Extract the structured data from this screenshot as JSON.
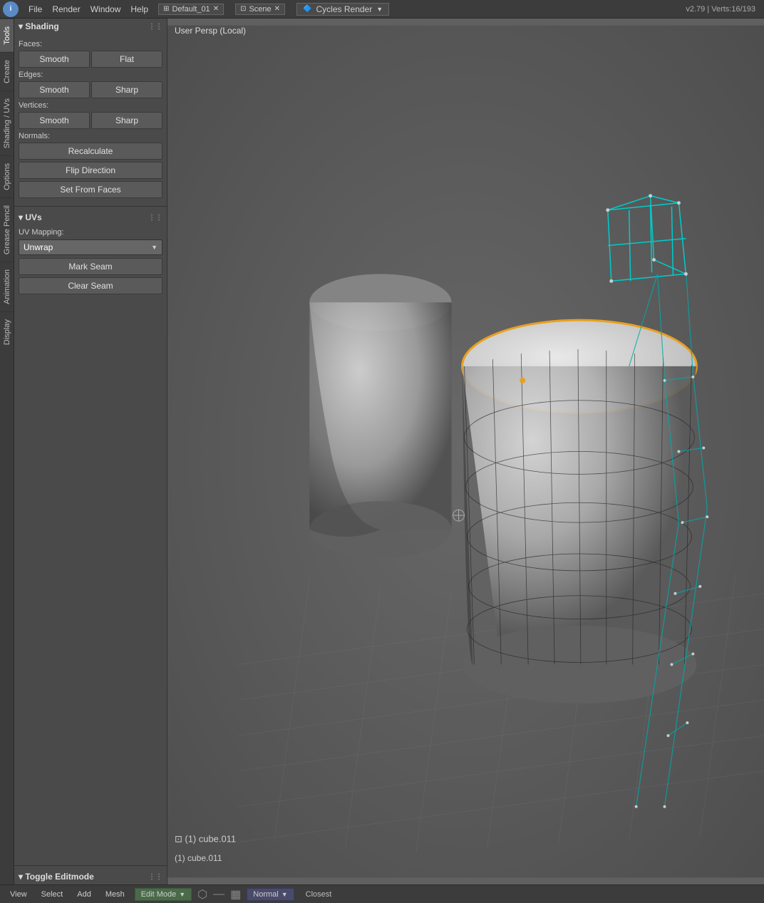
{
  "topbar": {
    "icon": "i",
    "menus": [
      "File",
      "Render",
      "Window",
      "Help"
    ],
    "screen_name": "Default_01",
    "scene_name": "Scene",
    "render_engine": "Cycles Render",
    "version": "v2.79 | Verts:16/193"
  },
  "sidebar": {
    "tabs": [
      "Tools",
      "Create",
      "Shading / UVs",
      "Options",
      "Grease Pencil",
      "Animation",
      "Display"
    ]
  },
  "shading": {
    "section_label": "Shading",
    "faces_label": "Faces:",
    "smooth_face_label": "Smooth",
    "flat_face_label": "Flat",
    "edges_label": "Edges:",
    "smooth_edge_label": "Smooth",
    "sharp_edge_label": "Sharp",
    "vertices_label": "Vertices:",
    "smooth_vert_label": "Smooth",
    "sharp_vert_label": "Sharp",
    "normals_label": "Normals:",
    "recalculate_label": "Recalculate",
    "flip_direction_label": "Flip Direction",
    "set_from_faces_label": "Set From Faces"
  },
  "uvs": {
    "section_label": "UVs",
    "uv_mapping_label": "UV Mapping:",
    "unwrap_label": "Unwrap",
    "mark_seam_label": "Mark Seam",
    "clear_seam_label": "Clear Seam"
  },
  "toggle_editmode": {
    "label": "Toggle Editmode"
  },
  "viewport": {
    "perspective_label": "User Persp (Local)"
  },
  "bottombar": {
    "view_label": "View",
    "select_label": "Select",
    "add_label": "Add",
    "mesh_label": "Mesh",
    "mode_label": "Edit Mode",
    "normal_label": "Normal",
    "closest_label": "Closest",
    "status": "(1) cube.011"
  }
}
